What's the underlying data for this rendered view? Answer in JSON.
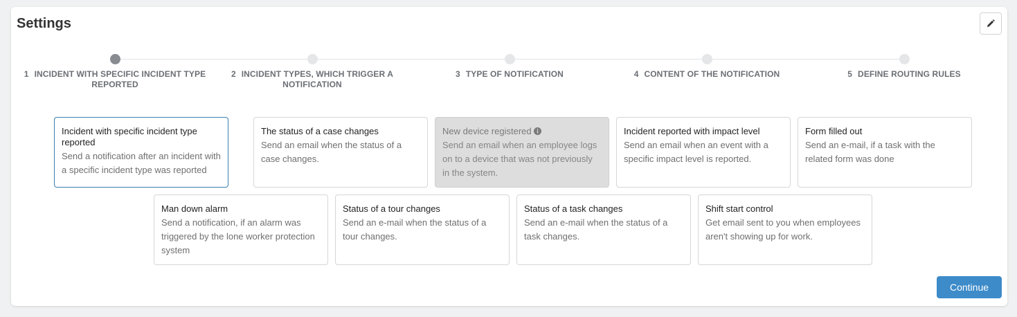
{
  "header": {
    "title": "Settings",
    "edit_icon": "pencil-icon"
  },
  "steps": [
    {
      "number": "1",
      "label": "INCIDENT WITH SPECIFIC INCIDENT TYPE REPORTED",
      "active": true
    },
    {
      "number": "2",
      "label": "INCIDENT TYPES, WHICH TRIGGER A NOTIFICATION",
      "active": false
    },
    {
      "number": "3",
      "label": "TYPE OF NOTIFICATION",
      "active": false
    },
    {
      "number": "4",
      "label": "CONTENT OF THE NOTIFICATION",
      "active": false
    },
    {
      "number": "5",
      "label": "DEFINE ROUTING RULES",
      "active": false
    }
  ],
  "cards": [
    {
      "title": "Incident with specific incident type reported",
      "description": "Send a notification after an incident with a specific incident type was reported",
      "state": "selected"
    },
    {
      "title": "The status of a case changes",
      "description": "Send an email when the status of a case changes.",
      "state": "normal"
    },
    {
      "title": "New device registered",
      "description": "Send an email when an employee logs on to a device that was not previously in the system.",
      "state": "disabled",
      "icon": "info-icon"
    },
    {
      "title": "Incident reported with impact level",
      "description": "Send an email when an event with a specific impact level is reported.",
      "state": "normal"
    },
    {
      "title": "Form filled out",
      "description": "Send an e-mail, if a task with the related form was done",
      "state": "normal"
    },
    {
      "title": "Man down alarm",
      "description": "Send a notification, if an alarm was triggered by the lone worker protection system",
      "state": "normal"
    },
    {
      "title": "Status of a tour changes",
      "description": "Send an e-mail when the status of a tour changes.",
      "state": "normal"
    },
    {
      "title": "Status of a task changes",
      "description": "Send an e-mail when the status of a task changes.",
      "state": "normal"
    },
    {
      "title": "Shift start control",
      "description": "Get email sent to you when employees aren't showing up for work.",
      "state": "normal"
    }
  ],
  "footer": {
    "continue_label": "Continue"
  },
  "colors": {
    "accent": "#3d8bc9",
    "selected_border": "#3a7fb0",
    "active_step": "#888c91",
    "inactive_step": "#e4e6e8"
  }
}
